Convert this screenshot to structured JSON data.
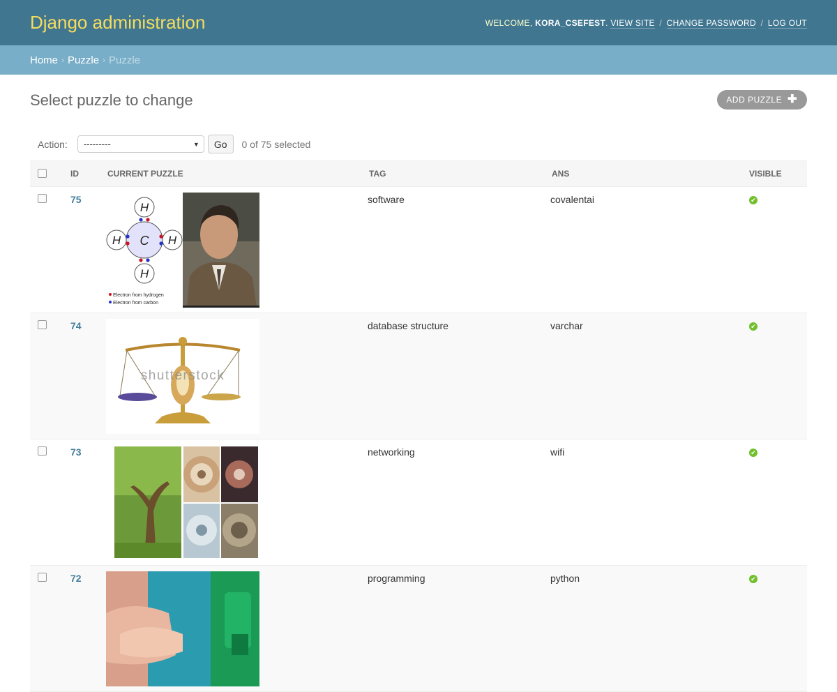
{
  "header": {
    "brand": "Django administration",
    "welcome": "WELCOME,",
    "username": "KORA_CSEFEST",
    "view_site": "VIEW SITE",
    "change_password": "CHANGE PASSWORD",
    "log_out": "LOG OUT"
  },
  "breadcrumbs": {
    "home": "Home",
    "app": "Puzzle",
    "current": "Puzzle"
  },
  "page": {
    "title": "Select puzzle to change",
    "add_button": "ADD PUZZLE"
  },
  "actions": {
    "label": "Action:",
    "selected": "---------",
    "go": "Go",
    "counter": "0 of 75 selected"
  },
  "table": {
    "columns": [
      "ID",
      "CURRENT PUZZLE",
      "TAG",
      "ANS",
      "VISIBLE"
    ],
    "rows": [
      {
        "id": "75",
        "tag": "software",
        "ans": "covalentai",
        "visible": true
      },
      {
        "id": "74",
        "tag": "database structure",
        "ans": "varchar",
        "visible": true
      },
      {
        "id": "73",
        "tag": "networking",
        "ans": "wifi",
        "visible": true
      },
      {
        "id": "72",
        "tag": "programming",
        "ans": "python",
        "visible": true
      }
    ]
  },
  "image_text": {
    "h": "H",
    "c": "C",
    "legend_1": "Electron from hydrogen",
    "legend_2": "Electron from carbon",
    "watermark": "shutterstock"
  },
  "colors": {
    "header_bg": "#417690",
    "brand": "#f5dd5d",
    "breadcrumb_bg": "#79aec8",
    "link": "#447e9b",
    "visible_ok": "#70bf2b"
  }
}
